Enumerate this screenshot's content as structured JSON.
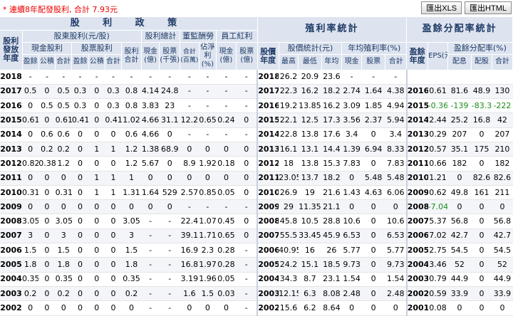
{
  "notice": "* 連續8年配發股利, 合計 7.93元",
  "buttons": {
    "xls": "匯出XLS",
    "html": "匯出HTML"
  },
  "headers": {
    "dividend_policy": "股 利 政 策",
    "yield_stats": "殖利率統計",
    "payout_stats": "盈餘分配率統計",
    "dividend_year": "股利發放年度",
    "shareholder_dividend": "股東股利(元/股)",
    "dividend_total": "股利總計",
    "director_comp": "董監酬勞",
    "employee_bonus": "員工紅利",
    "cash_dividend": "現金股利",
    "stock_dividend": "股票股利",
    "dividend_sum": "股利合計",
    "cash_100m": "現金(億)",
    "stock_k": "股票(千張)",
    "total_100m": "合計(百萬)",
    "pct_net_income": "佔淨利(%)",
    "emp_cash_100m": "現金(億)",
    "emp_stock_k": "股票(億)",
    "surplus": "盈餘",
    "reserve": "公積",
    "total": "合計",
    "price_year": "股價年度",
    "price_stats": "股價統計(元)",
    "annual_yield": "年均殖利率(%)",
    "high": "最高",
    "low": "最低",
    "avg": "年均",
    "cash": "現金",
    "stock": "股票",
    "sum": "合計",
    "earn_year": "盈餘年度",
    "eps": "EPS(元)",
    "payout_ratio": "盈餘分配率(%)",
    "payout_cash": "配息",
    "payout_stock": "配股"
  },
  "rows": [
    {
      "y": "2018",
      "c1": "-",
      "c2": "-",
      "c3": "-",
      "s1": "-",
      "s2": "-",
      "s3": "-",
      "t": "-",
      "cb": "-",
      "sb": "-",
      "dt": "-",
      "dp": "-",
      "ec": "-",
      "es": "-",
      "py": "2018",
      "hi": "26.2",
      "lo": "20.9",
      "av": "23.6",
      "yc": "-",
      "ys": "-",
      "yt": "-",
      "ey": "",
      "eps": "",
      "pc": "",
      "ps": "",
      "pt": ""
    },
    {
      "y": "2017",
      "c1": "0.5",
      "c2": "0",
      "c3": "0.5",
      "s1": "0.3",
      "s2": "0",
      "s3": "0.3",
      "t": "0.8",
      "cb": "4.14",
      "sb": "24.8",
      "dt": "-",
      "dp": "-",
      "ec": "-",
      "es": "-",
      "py": "2017",
      "hi": "22.3",
      "lo": "16.2",
      "av": "18.2",
      "yc": "2.74",
      "ys": "1.64",
      "yt": "4.38",
      "ey": "2016",
      "eps": "0.61",
      "pc": "81.6",
      "ps": "48.9",
      "pt": "130"
    },
    {
      "y": "2016",
      "c1": "0",
      "c2": "0.5",
      "c3": "0.5",
      "s1": "0.3",
      "s2": "0",
      "s3": "0.3",
      "t": "0.8",
      "cb": "3.83",
      "sb": "23",
      "dt": "-",
      "dp": "-",
      "ec": "-",
      "es": "-",
      "py": "2016",
      "hi": "19.2",
      "lo": "13.85",
      "av": "16.2",
      "yc": "3.09",
      "ys": "1.85",
      "yt": "4.94",
      "ey": "2015",
      "eps": "-0.36",
      "pc": "-139",
      "ps": "-83.3",
      "pt": "-222"
    },
    {
      "y": "2015",
      "c1": "0.61",
      "c2": "0",
      "c3": "0.61",
      "s1": "0.41",
      "s2": "0",
      "s3": "0.41",
      "t": "1.02",
      "cb": "4.66",
      "sb": "31.1",
      "dt": "12.2",
      "dp": "0.65",
      "ec": "0.24",
      "es": "0",
      "py": "2015",
      "hi": "22.1",
      "lo": "12.5",
      "av": "17.3",
      "yc": "3.56",
      "ys": "2.37",
      "yt": "5.94",
      "ey": "2014",
      "eps": "2.44",
      "pc": "25.2",
      "ps": "16.8",
      "pt": "42"
    },
    {
      "y": "2014",
      "c1": "0",
      "c2": "0.6",
      "c3": "0.6",
      "s1": "0",
      "s2": "0",
      "s3": "0",
      "t": "0.6",
      "cb": "4.66",
      "sb": "0",
      "dt": "-",
      "dp": "-",
      "ec": "-",
      "es": "-",
      "py": "2014",
      "hi": "22.8",
      "lo": "13.8",
      "av": "17.6",
      "yc": "3.4",
      "ys": "0",
      "yt": "3.4",
      "ey": "2013",
      "eps": "0.29",
      "pc": "207",
      "ps": "0",
      "pt": "207"
    },
    {
      "y": "2013",
      "c1": "0",
      "c2": "0.2",
      "c3": "0.2",
      "s1": "0",
      "s2": "1",
      "s3": "1",
      "t": "1.2",
      "cb": "1.38",
      "sb": "68.9",
      "dt": "0",
      "dp": "0",
      "ec": "0",
      "es": "0",
      "py": "2013",
      "hi": "16.1",
      "lo": "13.1",
      "av": "14.4",
      "yc": "1.39",
      "ys": "6.94",
      "yt": "8.33",
      "ey": "2012",
      "eps": "0.57",
      "pc": "35.1",
      "ps": "175",
      "pt": "210"
    },
    {
      "y": "2012",
      "c1": "0.82",
      "c2": "0.38",
      "c3": "1.2",
      "s1": "0",
      "s2": "0",
      "s3": "0",
      "t": "1.2",
      "cb": "5.67",
      "sb": "0",
      "dt": "8.9",
      "dp": "1.92",
      "ec": "0.18",
      "es": "0",
      "py": "2012",
      "hi": "18",
      "lo": "13.8",
      "av": "15.3",
      "yc": "7.83",
      "ys": "0",
      "yt": "7.83",
      "ey": "2011",
      "eps": "0.66",
      "pc": "182",
      "ps": "0",
      "pt": "182"
    },
    {
      "y": "2011",
      "c1": "0",
      "c2": "0",
      "c3": "0",
      "s1": "0",
      "s2": "1",
      "s3": "1",
      "t": "1",
      "cb": "0",
      "sb": "0",
      "dt": "0",
      "dp": "0",
      "ec": "0",
      "es": "0",
      "py": "2011",
      "hi": "23.05",
      "lo": "13.7",
      "av": "18.2",
      "yc": "0",
      "ys": "5.48",
      "yt": "5.48",
      "ey": "2010",
      "eps": "1.21",
      "pc": "0",
      "ps": "82.6",
      "pt": "82.6"
    },
    {
      "y": "2010",
      "c1": "0.31",
      "c2": "0",
      "c3": "0.31",
      "s1": "0",
      "s2": "1",
      "s3": "1",
      "t": "1.31",
      "cb": "1.64",
      "sb": "529",
      "dt": "2.57",
      "dp": "0.85",
      "ec": "0.05",
      "es": "0",
      "py": "2010",
      "hi": "26.9",
      "lo": "19",
      "av": "21.6",
      "yc": "1.43",
      "ys": "4.63",
      "yt": "6.06",
      "ey": "2009",
      "eps": "0.62",
      "pc": "49.8",
      "ps": "161",
      "pt": "211"
    },
    {
      "y": "2009",
      "c1": "0",
      "c2": "0",
      "c3": "0",
      "s1": "0",
      "s2": "0",
      "s3": "0",
      "t": "0",
      "cb": "0",
      "sb": "0",
      "dt": "-",
      "dp": "-",
      "ec": "-",
      "es": "-",
      "py": "2009",
      "hi": "29",
      "lo": "11.35",
      "av": "21.1",
      "yc": "0",
      "ys": "0",
      "yt": "0",
      "ey": "2008",
      "eps": "-7.04",
      "pc": "0",
      "ps": "0",
      "pt": "0"
    },
    {
      "y": "2008",
      "c1": "3.05",
      "c2": "0",
      "c3": "3.05",
      "s1": "0",
      "s2": "0",
      "s3": "0",
      "t": "3.05",
      "cb": "-",
      "sb": "-",
      "dt": "22.4",
      "dp": "1.07",
      "ec": "0.45",
      "es": "0",
      "py": "2008",
      "hi": "45.8",
      "lo": "10.5",
      "av": "28.8",
      "yc": "10.6",
      "ys": "0",
      "yt": "10.6",
      "ey": "2007",
      "eps": "5.37",
      "pc": "56.8",
      "ps": "0",
      "pt": "56.8"
    },
    {
      "y": "2007",
      "c1": "3",
      "c2": "0",
      "c3": "3",
      "s1": "0",
      "s2": "0",
      "s3": "0",
      "t": "3",
      "cb": "-",
      "sb": "-",
      "dt": "39.1",
      "dp": "1.71",
      "ec": "0.65",
      "es": "0",
      "py": "2007",
      "hi": "55.5",
      "lo": "33.45",
      "av": "45.9",
      "yc": "6.53",
      "ys": "0",
      "yt": "6.53",
      "ey": "2006",
      "eps": "7.02",
      "pc": "42.7",
      "ps": "0",
      "pt": "42.7"
    },
    {
      "y": "2006",
      "c1": "1.5",
      "c2": "0",
      "c3": "1.5",
      "s1": "0",
      "s2": "0",
      "s3": "0",
      "t": "1.5",
      "cb": "-",
      "sb": "-",
      "dt": "16.9",
      "dp": "2.3",
      "ec": "0.28",
      "es": "-",
      "py": "2006",
      "hi": "40.95",
      "lo": "16",
      "av": "26",
      "yc": "5.77",
      "ys": "0",
      "yt": "5.77",
      "ey": "2005",
      "eps": "2.75",
      "pc": "54.5",
      "ps": "0",
      "pt": "54.5"
    },
    {
      "y": "2005",
      "c1": "1.8",
      "c2": "0",
      "c3": "1.8",
      "s1": "0",
      "s2": "0",
      "s3": "0",
      "t": "1.8",
      "cb": "-",
      "sb": "-",
      "dt": "16.8",
      "dp": "1.97",
      "ec": "0.28",
      "es": "-",
      "py": "2005",
      "hi": "24.2",
      "lo": "15.1",
      "av": "18.5",
      "yc": "9.73",
      "ys": "0",
      "yt": "9.73",
      "ey": "2004",
      "eps": "3.46",
      "pc": "52",
      "ps": "0",
      "pt": "52"
    },
    {
      "y": "2004",
      "c1": "0.35",
      "c2": "0",
      "c3": "0.35",
      "s1": "0",
      "s2": "0",
      "s3": "0",
      "t": "0.35",
      "cb": "-",
      "sb": "-",
      "dt": "3.19",
      "dp": "1.96",
      "ec": "0.05",
      "es": "-",
      "py": "2004",
      "hi": "34.3",
      "lo": "8.7",
      "av": "23.1",
      "yc": "1.54",
      "ys": "0",
      "yt": "1.54",
      "ey": "2003",
      "eps": "0.79",
      "pc": "44.9",
      "ps": "0",
      "pt": "44.9"
    },
    {
      "y": "2003",
      "c1": "0.2",
      "c2": "0",
      "c3": "0.2",
      "s1": "0",
      "s2": "0",
      "s3": "0",
      "t": "0.2",
      "cb": "-",
      "sb": "-",
      "dt": "1.6",
      "dp": "1.5",
      "ec": "0.03",
      "es": "-",
      "py": "2003",
      "hi": "12.15",
      "lo": "6.3",
      "av": "8.08",
      "yc": "2.48",
      "ys": "0",
      "yt": "2.48",
      "ey": "2002",
      "eps": "0.59",
      "pc": "33.9",
      "ps": "0",
      "pt": "33.9"
    },
    {
      "y": "2002",
      "c1": "0",
      "c2": "0",
      "c3": "0",
      "s1": "0",
      "s2": "0",
      "s3": "0",
      "t": "0",
      "cb": "-",
      "sb": "-",
      "dt": "0",
      "dp": "0",
      "ec": "0",
      "es": "-",
      "py": "2002",
      "hi": "15.6",
      "lo": "6.2",
      "av": "8.64",
      "yc": "0",
      "ys": "0",
      "yt": "0",
      "ey": "2001",
      "eps": "0.08",
      "pc": "0",
      "ps": "0",
      "pt": "0"
    }
  ]
}
